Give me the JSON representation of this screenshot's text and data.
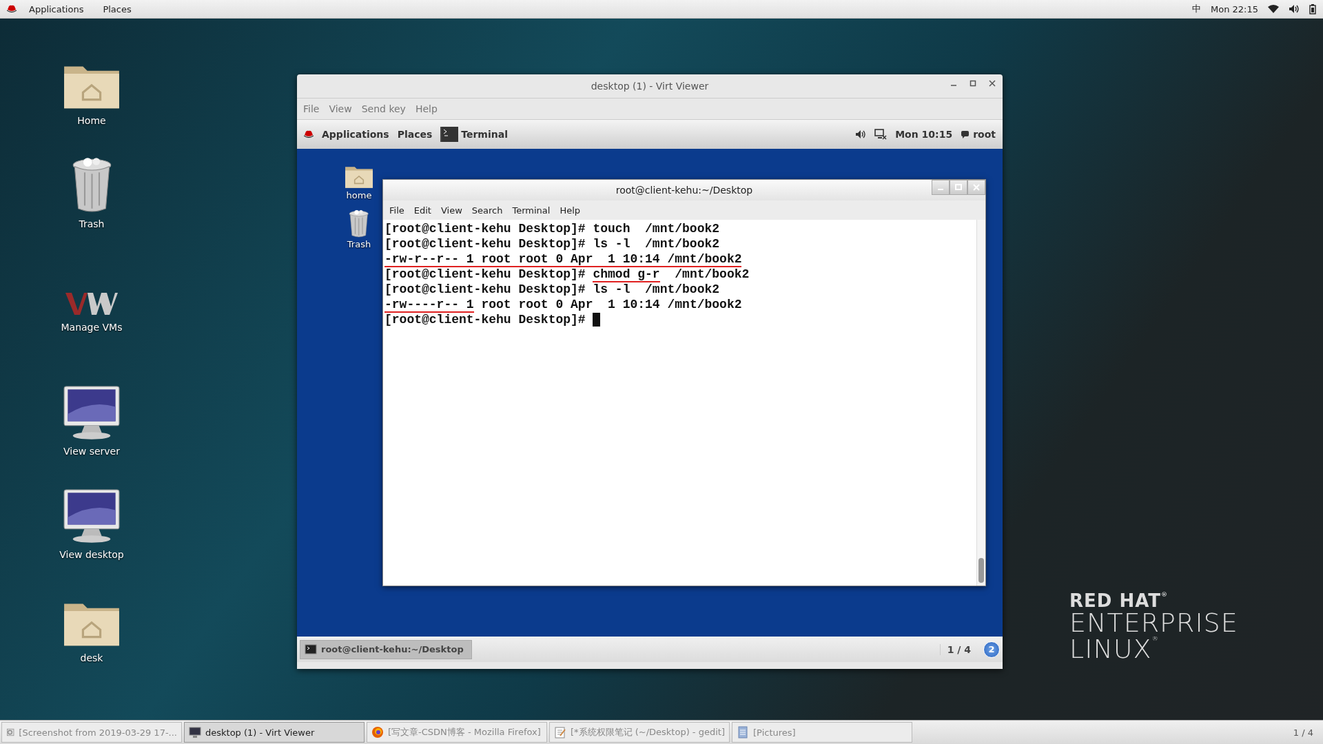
{
  "top_bar": {
    "menu": [
      "Applications",
      "Places"
    ],
    "input_method": "中",
    "clock": "Mon 22:15"
  },
  "desktop_icons": [
    {
      "kind": "folder",
      "label": "Home"
    },
    {
      "kind": "trash",
      "label": "Trash"
    },
    {
      "kind": "vm",
      "label": "Manage VMs"
    },
    {
      "kind": "monitor",
      "label": "View server"
    },
    {
      "kind": "monitor",
      "label": "View desktop"
    },
    {
      "kind": "folder",
      "label": "desk"
    }
  ],
  "viewer": {
    "title": "desktop (1) - Virt Viewer",
    "menu": [
      "File",
      "View",
      "Send key",
      "Help"
    ],
    "guest": {
      "top_bar": {
        "menu": [
          "Applications",
          "Places"
        ],
        "app": "Terminal",
        "clock": "Mon 10:15",
        "user": "root"
      },
      "desktop_icons": [
        {
          "kind": "folder",
          "label": "home"
        },
        {
          "kind": "trash",
          "label": "Trash"
        }
      ],
      "terminal": {
        "title": "root@client-kehu:~/Desktop",
        "menu": [
          "File",
          "Edit",
          "View",
          "Search",
          "Terminal",
          "Help"
        ],
        "lines": [
          [
            {
              "text": "[root@client-kehu Desktop]# touch  /mnt/book2",
              "underlined": false
            }
          ],
          [
            {
              "text": "[root@client-kehu Desktop]# ls -l  /mnt/book2",
              "underlined": false
            }
          ],
          [
            {
              "text": "-rw-r--r-- 1 root root 0 Apr  1 10:14 /mnt/book2",
              "underlined": true
            }
          ],
          [
            {
              "text": "[root@client-kehu Desktop]# ",
              "underlined": false
            },
            {
              "text": "chmod g-r",
              "underlined": true
            },
            {
              "text": "  /mnt/book2",
              "underlined": false
            }
          ],
          [
            {
              "text": "[root@client-kehu Desktop]# ls -l  /mnt/book2",
              "underlined": false
            }
          ],
          [
            {
              "text": "-rw----r-- 1",
              "underlined": true
            },
            {
              "text": " root root 0 Apr  1 10:14 /mnt/book2",
              "underlined": false
            }
          ],
          [
            {
              "text": "[root@client-kehu Desktop]# ",
              "underlined": false
            }
          ]
        ]
      },
      "taskbar": {
        "window": "root@client-kehu:~/Desktop",
        "workspace": "1 / 4",
        "notifications": "2"
      }
    }
  },
  "logo": {
    "line_1": "RED HAT$^{®}$",
    "line_2": "ENTERPRISE",
    "line_3": "LINUX$^{®}$"
  },
  "taskbar": {
    "items": [
      {
        "kind": "image",
        "label": "[Screenshot from 2019-03-29 17-...",
        "selected": false
      },
      {
        "kind": "monitor",
        "label": "desktop (1) - Virt Viewer",
        "selected": true
      },
      {
        "kind": "browser",
        "label": "[写文章-CSDN博客 - Mozilla Firefox]",
        "selected": false
      },
      {
        "kind": "editor",
        "label": "[*系统权限笔记 (~/Desktop) - gedit]",
        "selected": false
      },
      {
        "kind": "viewer",
        "label": "[Pictures]",
        "selected": false
      }
    ],
    "workspace": "1 / 4"
  }
}
